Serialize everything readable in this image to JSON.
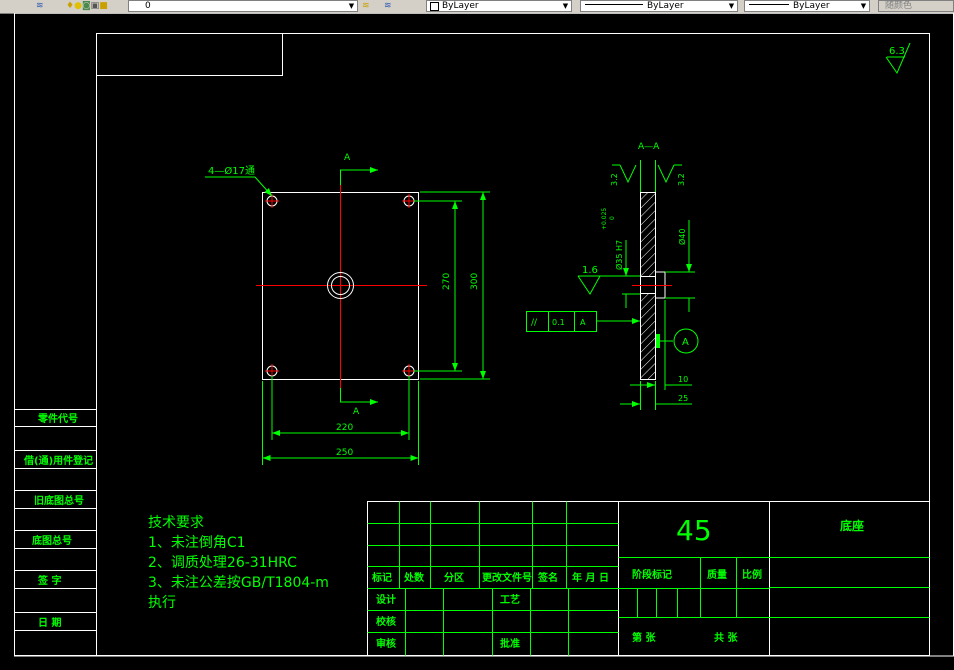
{
  "toolbar": {
    "layer_value": "0",
    "color_value": "ByLayer",
    "linetype_value": "ByLayer",
    "lineweight_value": "ByLayer",
    "plotstyle_value": "随颜色"
  },
  "drawing": {
    "roughness_main": "6.3",
    "roughness_local": "1.6",
    "plan_view": {
      "section_mark_top": "A",
      "section_mark_bottom": "A",
      "hole_callout": "4—Ø17通",
      "dim_270": "270",
      "dim_300": "300",
      "dim_220": "220",
      "dim_250": "250"
    },
    "section_view": {
      "title": "A—A",
      "roughness_left": "3.2",
      "roughness_right": "3.2",
      "dim_bore": "Ø35 H7",
      "tol_upper": "+0.025",
      "tol_lower": "0",
      "dim_40": "Ø40",
      "dim_10": "10",
      "dim_25": "25",
      "datum_letter": "A",
      "gdt_symbol": "//",
      "gdt_value": "0.1",
      "gdt_datum": "A"
    },
    "tech_requirements": {
      "title": "技术要求",
      "item1": "1、未注倒角C1",
      "item2": "2、调质处理26-31HRC",
      "item3": "3、未注公差按GB/T1804-m",
      "item3_cont": "执行"
    },
    "side_column": {
      "r1": "零件代号",
      "r2": "借(通)用件登记",
      "r3": "旧底图总号",
      "r4": "底图总号",
      "r5": "签    字",
      "r6": "日    期"
    },
    "title_block": {
      "material": "45",
      "part_name": "底座",
      "h_mark": "标记",
      "h_count": "处数",
      "h_zone": "分区",
      "h_docno": "更改文件号",
      "h_sign": "签名",
      "h_date": "年 月 日",
      "r_design": "设计",
      "r_check": "校核",
      "r_review": "审核",
      "r_process": "工艺",
      "r_approve": "批准",
      "stage_label": "阶段标记",
      "weight_label": "质量",
      "scale_label": "比例",
      "sheets_total": "共    张",
      "sheet_no": "第    张"
    }
  }
}
